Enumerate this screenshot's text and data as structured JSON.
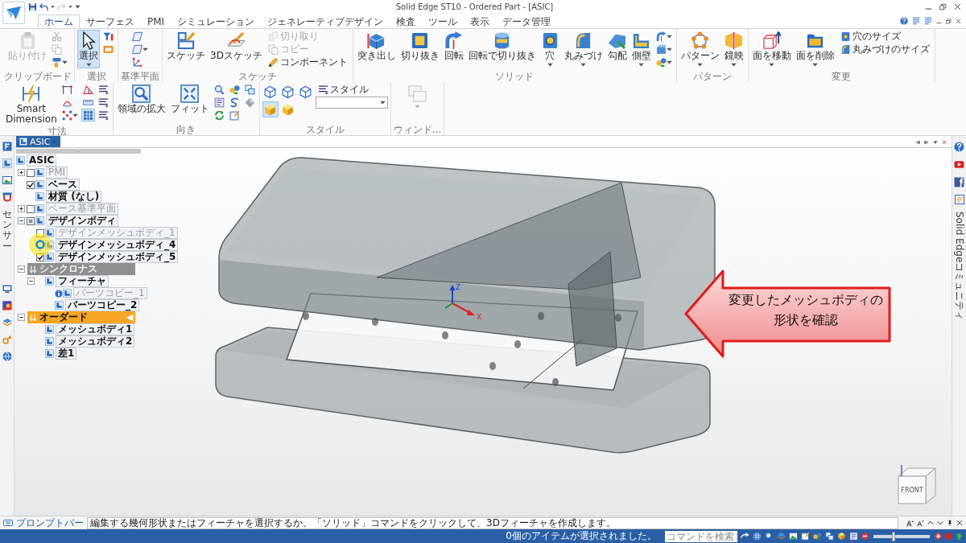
{
  "window": {
    "title": "Solid Edge ST10 - Ordered Part - [ASIC]"
  },
  "ribbon_tabs": [
    {
      "label": "ホーム",
      "selected": true
    },
    {
      "label": "サーフェス",
      "selected": false
    },
    {
      "label": "PMI",
      "selected": false
    },
    {
      "label": "シミュレーション",
      "selected": false
    },
    {
      "label": "ジェネレーティブデザイン",
      "selected": false
    },
    {
      "label": "検査",
      "selected": false
    },
    {
      "label": "ツール",
      "selected": false
    },
    {
      "label": "表示",
      "selected": false
    },
    {
      "label": "データ管理",
      "selected": false
    }
  ],
  "ribbon_groups": [
    {
      "label": "クリップボード",
      "buttons": [
        {
          "kind": "large",
          "label": "貼り付け",
          "menu": false,
          "disabled": true,
          "active": false
        },
        {
          "kind": "icon",
          "menu": false,
          "disabled": true,
          "active": false
        },
        {
          "kind": "icon",
          "menu": false,
          "disabled": true,
          "active": false
        },
        {
          "kind": "icon",
          "menu": true,
          "disabled": false,
          "active": false
        }
      ]
    },
    {
      "label": "選択",
      "buttons": [
        {
          "kind": "large",
          "label": "選択",
          "menu": true,
          "disabled": false,
          "active": true
        },
        {
          "kind": "icon",
          "menu": false,
          "disabled": false,
          "active": false
        },
        {
          "kind": "icon",
          "menu": false,
          "disabled": false,
          "active": false
        }
      ]
    },
    {
      "label": "基準平面",
      "buttons": [
        {
          "kind": "icon",
          "menu": false,
          "disabled": false,
          "active": false
        },
        {
          "kind": "icon",
          "menu": true,
          "disabled": false,
          "active": false
        },
        {
          "kind": "icon",
          "menu": false,
          "disabled": false,
          "active": false
        }
      ]
    },
    {
      "label": "スケッチ",
      "buttons": [
        {
          "kind": "large",
          "label": "スケッチ",
          "menu": false,
          "disabled": false,
          "active": false
        },
        {
          "kind": "large",
          "label": "3Dスケッチ",
          "menu": false,
          "disabled": false,
          "active": false
        },
        {
          "kind": "small",
          "label": "切り取り",
          "menu": false,
          "disabled": true,
          "active": false
        },
        {
          "kind": "small",
          "label": "コピー",
          "menu": false,
          "disabled": true,
          "active": false
        },
        {
          "kind": "small",
          "label": "コンポーネント",
          "menu": false,
          "disabled": false,
          "active": false
        }
      ]
    },
    {
      "label": "ソリッド",
      "buttons": [
        {
          "kind": "large",
          "label": "突き出し",
          "menu": false,
          "disabled": false,
          "active": false
        },
        {
          "kind": "large",
          "label": "切り抜き",
          "menu": false,
          "disabled": false,
          "active": false
        },
        {
          "kind": "large",
          "label": "回転",
          "menu": false,
          "disabled": false,
          "active": false
        },
        {
          "kind": "large",
          "label": "回転で切り抜き",
          "menu": false,
          "disabled": false,
          "active": false
        },
        {
          "kind": "large",
          "label": "穴",
          "menu": true,
          "disabled": false,
          "active": false
        },
        {
          "kind": "large",
          "label": "丸みづけ",
          "menu": true,
          "disabled": false,
          "active": false
        },
        {
          "kind": "large",
          "label": "勾配",
          "menu": false,
          "disabled": false,
          "active": false
        },
        {
          "kind": "large",
          "label": "側壁",
          "menu": true,
          "disabled": false,
          "active": false
        },
        {
          "kind": "icon",
          "menu": true,
          "disabled": false,
          "active": false
        },
        {
          "kind": "icon",
          "menu": true,
          "disabled": false,
          "active": false
        },
        {
          "kind": "icon",
          "menu": true,
          "disabled": false,
          "active": false
        }
      ]
    },
    {
      "label": "パターン",
      "buttons": [
        {
          "kind": "large",
          "label": "パターン",
          "menu": true,
          "disabled": false,
          "active": false
        },
        {
          "kind": "large",
          "label": "鏡映",
          "menu": true,
          "disabled": false,
          "active": false
        }
      ]
    },
    {
      "label": "変更",
      "buttons": [
        {
          "kind": "large",
          "label": "面を移動",
          "menu": true,
          "disabled": false,
          "active": false
        },
        {
          "kind": "large",
          "label": "面を削除",
          "menu": true,
          "disabled": false,
          "active": false
        },
        {
          "kind": "small",
          "label": "穴のサイズ",
          "menu": false,
          "disabled": false,
          "active": false
        },
        {
          "kind": "small",
          "label": "丸みづけのサイズ",
          "menu": false,
          "disabled": false,
          "active": false
        }
      ]
    },
    {
      "label": "寸法",
      "buttons": [
        {
          "kind": "large",
          "label": "Smart Dimension",
          "menu": false,
          "disabled": false,
          "active": false
        },
        {
          "kind": "icon",
          "menu": false,
          "disabled": false,
          "active": false
        },
        {
          "kind": "icon",
          "menu": false,
          "disabled": false,
          "active": false
        },
        {
          "kind": "icon",
          "menu": true,
          "disabled": false,
          "active": false
        },
        {
          "kind": "icon",
          "menu": false,
          "disabled": false,
          "active": false
        },
        {
          "kind": "icon",
          "menu": false,
          "disabled": false,
          "active": false
        },
        {
          "kind": "icon",
          "menu": false,
          "disabled": false,
          "active": true
        },
        {
          "kind": "icon",
          "menu": false,
          "disabled": false,
          "active": false
        },
        {
          "kind": "icon",
          "menu": false,
          "disabled": false,
          "active": false
        },
        {
          "kind": "icon",
          "menu": false,
          "disabled": false,
          "active": false
        }
      ]
    },
    {
      "label": "向き",
      "buttons": [
        {
          "kind": "large",
          "label": "領域の拡大",
          "menu": false,
          "disabled": false,
          "active": false
        },
        {
          "kind": "large",
          "label": "フィット",
          "menu": false,
          "disabled": false,
          "active": false
        },
        {
          "kind": "icon",
          "menu": false,
          "disabled": false,
          "active": false
        },
        {
          "kind": "icon",
          "menu": false,
          "disabled": false,
          "active": false
        },
        {
          "kind": "icon",
          "menu": false,
          "disabled": false,
          "active": false
        },
        {
          "kind": "icon",
          "menu": false,
          "disabled": false,
          "active": false
        },
        {
          "kind": "icon",
          "menu": false,
          "disabled": false,
          "active": false
        },
        {
          "kind": "icon",
          "menu": false,
          "disabled": false,
          "active": false
        },
        {
          "kind": "icon",
          "menu": false,
          "disabled": false,
          "active": false
        },
        {
          "kind": "icon",
          "menu": false,
          "disabled": false,
          "active": false
        }
      ]
    },
    {
      "label": "スタイル",
      "buttons": [
        {
          "kind": "tile",
          "menu": false,
          "disabled": false,
          "active": false
        },
        {
          "kind": "tile",
          "menu": false,
          "disabled": false,
          "active": false
        },
        {
          "kind": "tile",
          "menu": false,
          "disabled": false,
          "active": false
        },
        {
          "kind": "tile",
          "menu": false,
          "disabled": false,
          "active": true
        },
        {
          "kind": "tile",
          "menu": false,
          "disabled": false,
          "active": false
        },
        {
          "kind": "small",
          "label": "スタイル",
          "menu": false,
          "disabled": false,
          "active": false
        },
        {
          "kind": "dropdown",
          "menu": true,
          "disabled": false,
          "active": false
        }
      ]
    },
    {
      "label": "ウィンド...",
      "buttons": [
        {
          "kind": "large",
          "menu": true,
          "disabled": true,
          "active": false
        }
      ]
    }
  ],
  "document_tabs": [
    {
      "label": "ASIC",
      "selected": true
    }
  ],
  "left_dock": {
    "label": "センサー"
  },
  "pathfinder": {
    "tree": [
      {
        "label": "ASIC",
        "dimmed": false,
        "children": [
          {
            "kind": "node",
            "label": "PMI",
            "expanded": false,
            "checked": false,
            "partial": false,
            "dimmed": true
          },
          {
            "kind": "node",
            "label": "ベース",
            "checked": true,
            "partial": false,
            "dimmed": false
          },
          {
            "kind": "node",
            "label": "材質 (なし)",
            "dimmed": false
          },
          {
            "kind": "node",
            "label": "ベース基準平面",
            "expanded": false,
            "checked": false,
            "partial": false,
            "dimmed": true
          },
          {
            "kind": "node",
            "label": "デザインボディ",
            "expanded": true,
            "checked": false,
            "partial": true,
            "dimmed": false,
            "children": [
              {
                "label": "デザインメッシュボディ_1",
                "checked": false,
                "dimmed": true
              },
              {
                "label": "デザインメッシュボディ_4",
                "dimmed": false
              },
              {
                "label": "デザインメッシュボディ_5",
                "checked": true,
                "dimmed": false
              }
            ]
          },
          {
            "kind": "environment",
            "label": "シンクロナス",
            "expanded": true,
            "active": false,
            "dimmed": false,
            "children": [
              {
                "label": "フィーチャ",
                "expanded": true,
                "dimmed": false,
                "children": [
                  {
                    "label": "パーツコピー_1",
                    "info": true,
                    "dimmed": true
                  },
                  {
                    "label": "パーツコピー_2",
                    "info": false,
                    "dimmed": false
                  }
                ]
              }
            ]
          },
          {
            "kind": "environment",
            "label": "オーダード",
            "expanded": true,
            "active": true,
            "dimmed": false,
            "children": [
              {
                "label": "メッシュボディ1",
                "dimmed": false
              },
              {
                "label": "メッシュボディ2",
                "dimmed": false
              },
              {
                "label": "差1",
                "dimmed": false
              }
            ]
          }
        ]
      }
    ]
  },
  "viewport": {
    "axis_labels": [
      "Z",
      "X"
    ],
    "view_cube_label": "FRONT"
  },
  "callout": {
    "text": "変更したメッシュボディの形状を確認"
  },
  "right_dock": {
    "label": "Solid Edgeコミュニティ"
  },
  "prompt_bar": {
    "label": "プロンプトバー",
    "message": "編集する幾何形状またはフィーチャを選択するか、「ソリッド」コマンドをクリックして、3Dフィーチャを作成します。"
  },
  "status_bar": {
    "message": "0個のアイテムが選択されました。",
    "search": {
      "placeholder": "コマンドを検索"
    },
    "zoom_slider": {
      "level": 0.35
    }
  }
}
